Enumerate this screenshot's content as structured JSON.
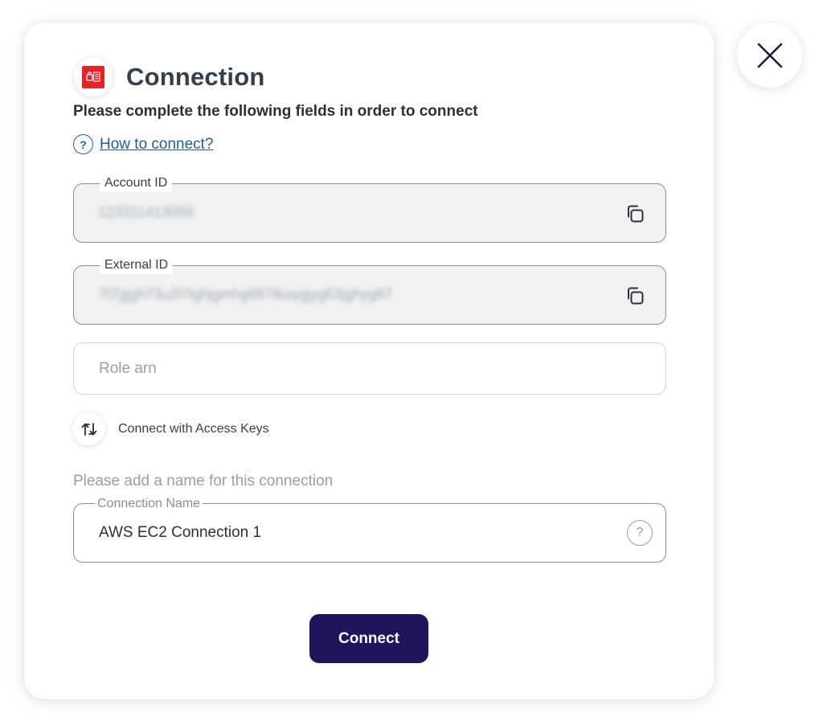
{
  "modal": {
    "title": "Connection",
    "subtitle": "Please complete the following fields in order to connect",
    "help_link": "How to connect?",
    "help_link_icon": "?",
    "logo_icon": "aws-ec2-logo-icon",
    "fields": {
      "account_id": {
        "label": "Account ID",
        "value": "123311413059",
        "copy_icon": "copy-icon"
      },
      "external_id": {
        "label": "External ID",
        "value": "7t7gjgh73u2l7tghjgmhg667tkuygjyg63gjhyg87",
        "copy_icon": "copy-icon"
      },
      "role_arn": {
        "placeholder": "Role arn",
        "value": ""
      }
    },
    "alt_connect": {
      "label": "Connect with Access Keys",
      "icon": "swap-arrows-icon"
    },
    "connection_name": {
      "hint": "Please add a name for this connection",
      "label": "Connection Name",
      "value": "AWS EC2 Connection 1",
      "help_icon": "?"
    },
    "connect_button": "Connect"
  },
  "close_icon": "close-icon",
  "colors": {
    "primary_button": "#20145c",
    "link": "#1f5d9e",
    "logo_red": "#e4242a",
    "readonly_bg": "#f1f1f1"
  }
}
